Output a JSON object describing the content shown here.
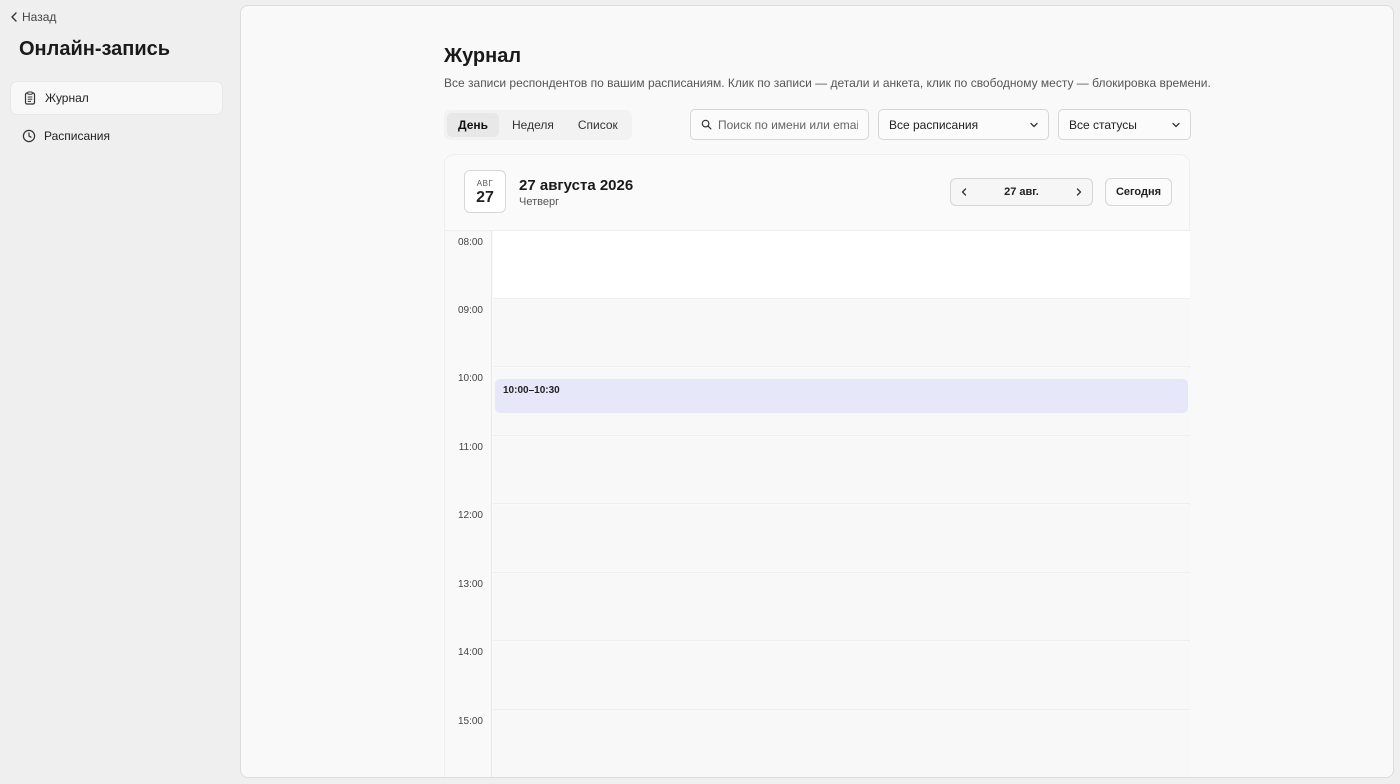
{
  "sidebar": {
    "back_label": "Назад",
    "app_title": "Онлайн-запись",
    "items": [
      {
        "label": "Журнал",
        "icon": "clipboard-icon",
        "active": true
      },
      {
        "label": "Расписания",
        "icon": "clock-icon",
        "active": false
      }
    ]
  },
  "main": {
    "title": "Журнал",
    "description": "Все записи респондентов по вашим расписаниям. Клик по записи — детали и анкета, клик по свободному месту — блокировка времени.",
    "view_tabs": [
      {
        "label": "День",
        "active": true
      },
      {
        "label": "Неделя",
        "active": false
      },
      {
        "label": "Список",
        "active": false
      }
    ],
    "search": {
      "placeholder": "Поиск по имени или email",
      "value": ""
    },
    "schedule_filter": {
      "value": "Все расписания"
    },
    "status_filter": {
      "value": "Все статусы"
    }
  },
  "calendar": {
    "badge_month": "АВГ",
    "badge_day": "27",
    "date_heading": "27 августа 2026",
    "weekday": "Четверг",
    "nav_label": "27 авг.",
    "today_label": "Сегодня",
    "hours": [
      "08:00",
      "09:00",
      "10:00",
      "11:00",
      "12:00",
      "13:00",
      "14:00",
      "15:00"
    ],
    "events": [
      {
        "time": "10:00–10:30"
      }
    ]
  },
  "colors": {
    "event_bg": "#e6e8fa",
    "background": "#efefef",
    "panel": "#f9f9f9"
  }
}
